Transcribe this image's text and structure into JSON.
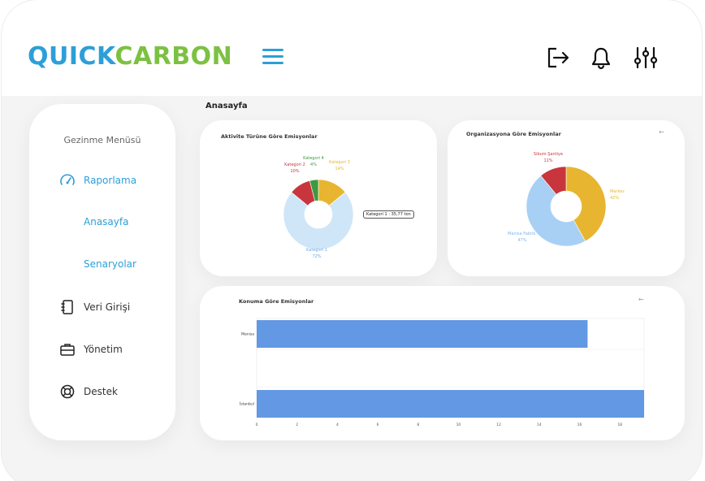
{
  "brand": {
    "part1": "QUICK",
    "part2": "CARBON",
    "color_primary": "#2d9fd8",
    "color_secondary": "#7cc142"
  },
  "header": {
    "icons": [
      "menu-icon",
      "logout-icon",
      "bell-icon",
      "sliders-icon"
    ]
  },
  "sidebar": {
    "title": "Gezinme Menüsü",
    "items": [
      {
        "label": "Raporlama",
        "icon": "gauge-icon",
        "active": true
      },
      {
        "label": "Veri Girişi",
        "icon": "notebook-icon"
      },
      {
        "label": "Yönetim",
        "icon": "briefcase-icon"
      },
      {
        "label": "Destek",
        "icon": "lifebuoy-icon"
      }
    ],
    "subitems": [
      {
        "label": "Anasayfa"
      },
      {
        "label": "Senaryolar"
      }
    ]
  },
  "main": {
    "page_title": "Anasayfa"
  },
  "cards": {
    "activity": {
      "title": "Aktivite Türüne Göre Emisyonlar",
      "tooltip": "Kategori 1 : 35,77 ton"
    },
    "organization": {
      "title": "Organizasyona Göre Emisyonlar",
      "back_arrow": "←"
    },
    "location": {
      "title": "Konuma Göre Emisyonlar",
      "back_arrow": "←"
    }
  },
  "chart_data": [
    {
      "type": "pie",
      "title": "Aktivite Türüne Göre Emisyonlar",
      "categories": [
        "Kategori 1",
        "Kategori 2",
        "Kategori 4",
        "Kategori 3"
      ],
      "labels": [
        "72%",
        "10%",
        "4%",
        "14%"
      ],
      "values": [
        72,
        10,
        4,
        14
      ],
      "colors": [
        "#cfe6f8",
        "#c9353c",
        "#3d9a3f",
        "#e8b530"
      ]
    },
    {
      "type": "pie",
      "title": "Organizasyona Göre Emisyonlar",
      "categories": [
        "Sibum Şantiye",
        "Merkez",
        "Manisa Fabrik."
      ],
      "labels": [
        "11%",
        "42%",
        "47%"
      ],
      "values": [
        11,
        42,
        47
      ],
      "colors": [
        "#c9353c",
        "#e8b530",
        "#a8d0f4"
      ]
    },
    {
      "type": "bar",
      "title": "Konuma Göre Emisyonlar",
      "categories": [
        "Manisa",
        "İstanbul"
      ],
      "values": [
        16.4,
        19.2
      ],
      "xlim": [
        0,
        19.2
      ],
      "xticks": [
        "0",
        "2",
        "4",
        "6",
        "8",
        "10",
        "12",
        "14",
        "16",
        "18"
      ],
      "color": "#6398e4"
    }
  ]
}
